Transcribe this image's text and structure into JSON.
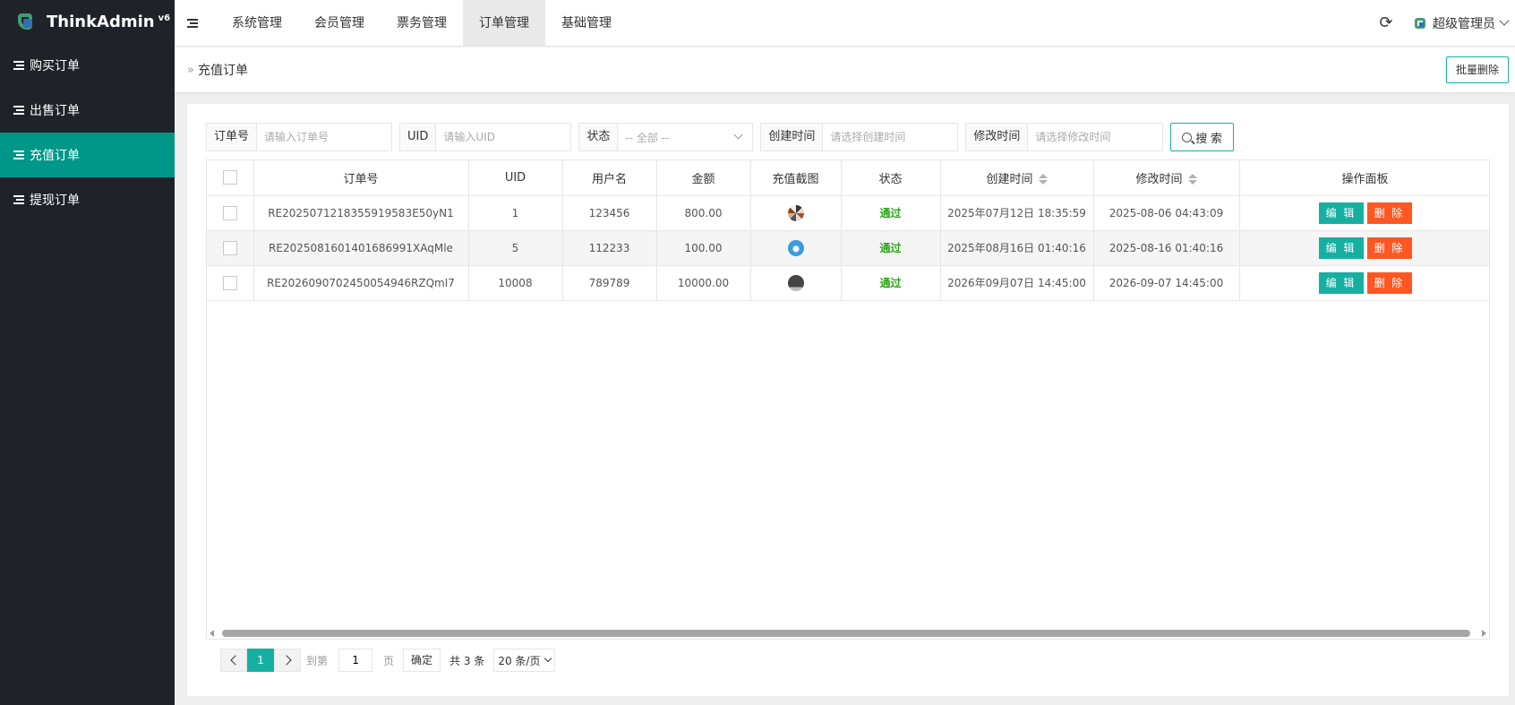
{
  "brand": {
    "name": "ThinkAdmin",
    "version": "v6"
  },
  "sidebar": {
    "items": [
      {
        "label": "购买订单"
      },
      {
        "label": "出售订单"
      },
      {
        "label": "充值订单"
      },
      {
        "label": "提现订单"
      }
    ]
  },
  "header": {
    "tabs": [
      {
        "label": "系统管理"
      },
      {
        "label": "会员管理"
      },
      {
        "label": "票务管理"
      },
      {
        "label": "订单管理"
      },
      {
        "label": "基础管理"
      }
    ],
    "user": "超级管理员"
  },
  "breadcrumb": {
    "arrow": "»",
    "title": "充值订单",
    "batch_delete": "批量删除"
  },
  "search": {
    "order_no": {
      "label": "订单号",
      "placeholder": "请输入订单号"
    },
    "uid": {
      "label": "UID",
      "placeholder": "请输入UID"
    },
    "status": {
      "label": "状态",
      "value": "-- 全部 --"
    },
    "created": {
      "label": "创建时间",
      "placeholder": "请选择创建时间"
    },
    "modified": {
      "label": "修改时间",
      "placeholder": "请选择修改时间"
    },
    "button": "搜 索"
  },
  "table": {
    "headers": [
      "订单号",
      "UID",
      "用户名",
      "金额",
      "充值截图",
      "状态",
      "创建时间",
      "修改时间",
      "操作面板"
    ],
    "rows": [
      {
        "order_no": "RE2025071218355919583E50yN1",
        "uid": "1",
        "username": "123456",
        "amount": "800.00",
        "thumb": "pinwheel-thumbnail",
        "status": "通过",
        "created": "2025年07月12日 18:35:59",
        "modified": "2025-08-06 04:43:09"
      },
      {
        "order_no": "RE2025081601401686991XAqMle",
        "uid": "5",
        "username": "112233",
        "amount": "100.00",
        "thumb": "blue-circle-thumbnail",
        "status": "通过",
        "created": "2025年08月16日 01:40:16",
        "modified": "2025-08-16 01:40:16"
      },
      {
        "order_no": "RE2026090702450054946RZQmI7",
        "uid": "10008",
        "username": "789789",
        "amount": "10000.00",
        "thumb": "dark-circle-thumbnail",
        "status": "通过",
        "created": "2026年09月07日 14:45:00",
        "modified": "2026-09-07 14:45:00"
      }
    ],
    "edit_label": "编 辑",
    "delete_label": "删 除"
  },
  "pagination": {
    "current": "1",
    "goto_prefix": "到第",
    "goto_value": "1",
    "goto_suffix": "页",
    "confirm": "确定",
    "total": "共 3 条",
    "page_size": "20 条/页"
  },
  "colors": {
    "accent": "#16b0a2",
    "danger": "#ff5722",
    "sidebar_bg": "#20222a",
    "sidebar_active": "#009688",
    "status_ok": "#2aa515"
  }
}
